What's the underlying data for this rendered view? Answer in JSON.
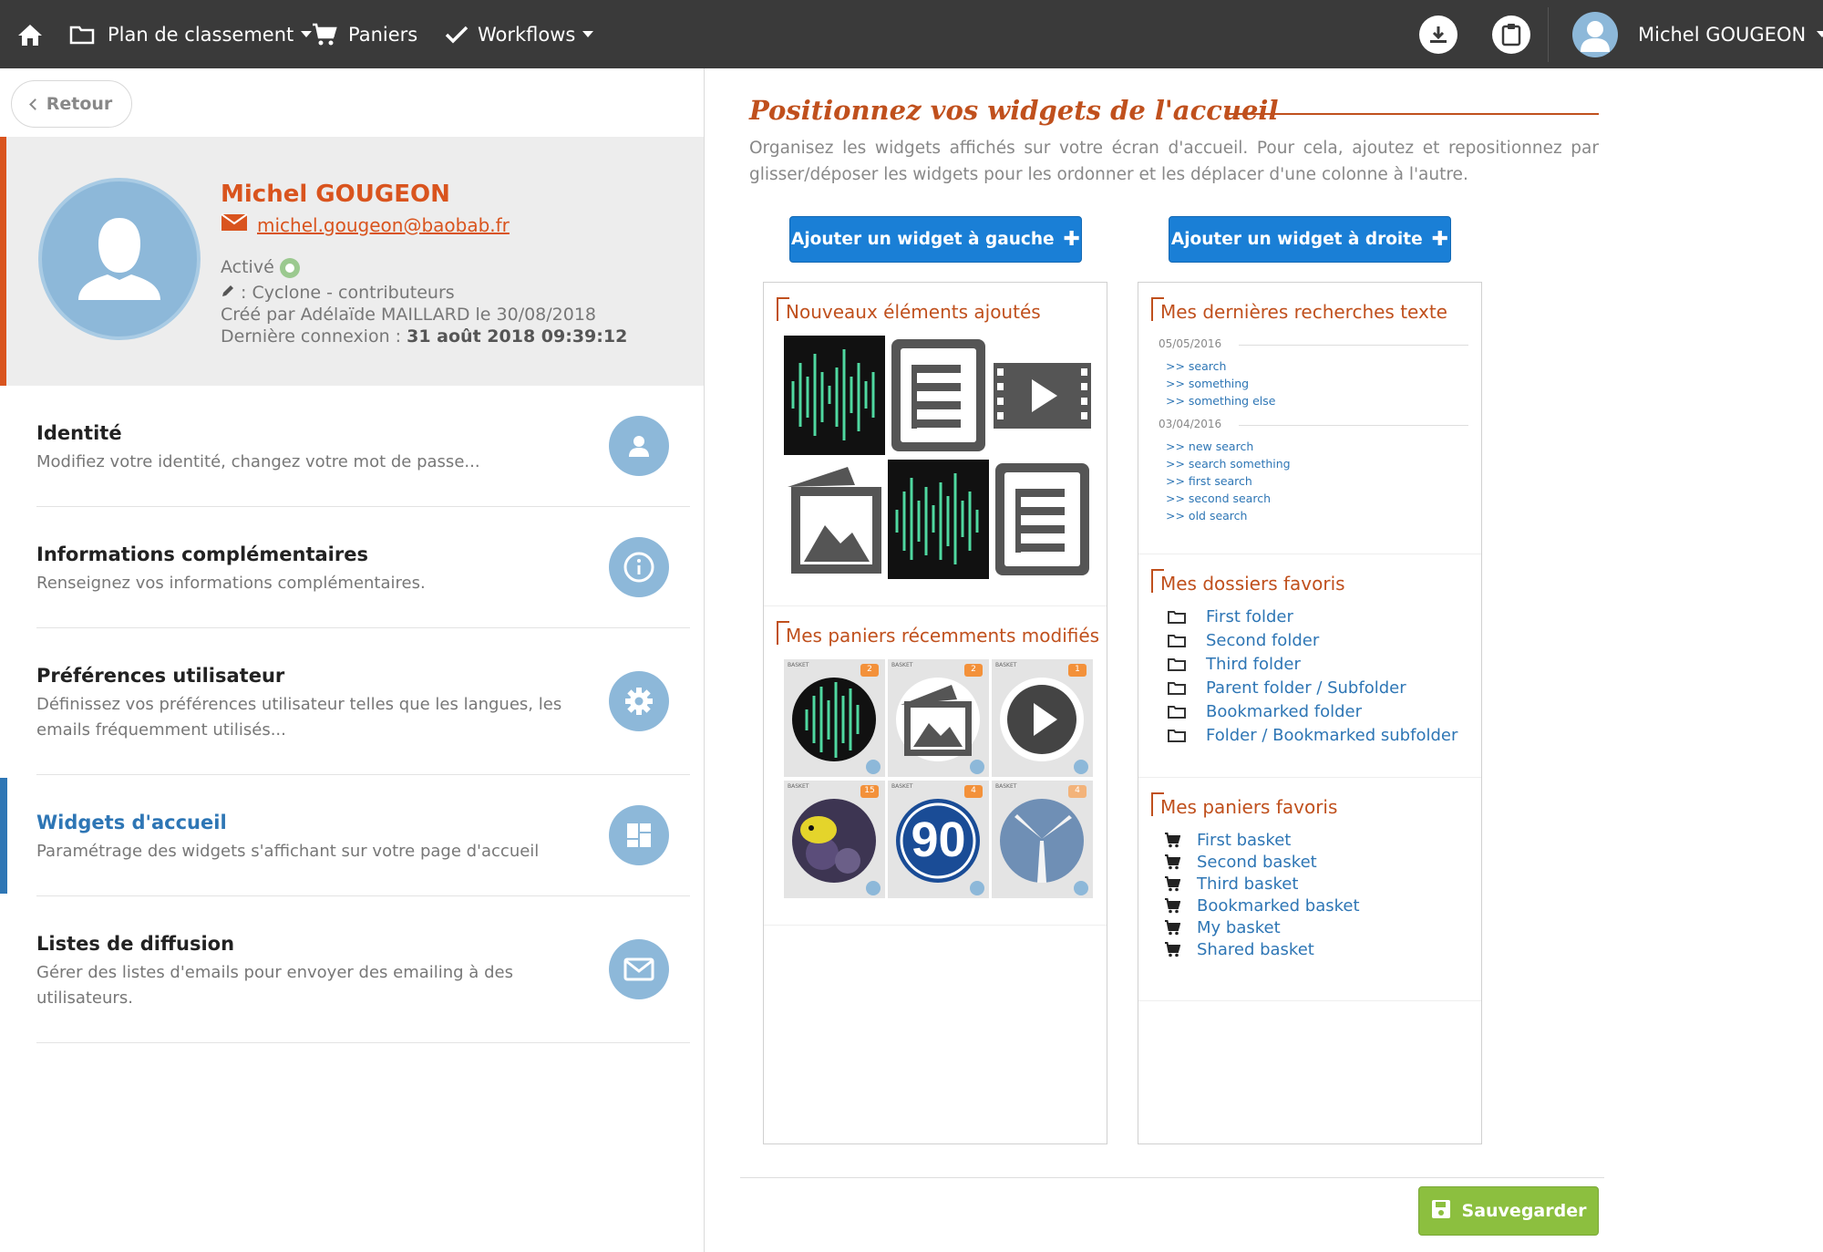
{
  "nav": {
    "plan_label": "Plan de classement",
    "baskets_label": "Paniers",
    "workflows_label": "Workflows",
    "user_name": "Michel GOUGEON"
  },
  "back_label": "Retour",
  "profile": {
    "name": "Michel GOUGEON",
    "email": "michel.gougeon@baobab.fr",
    "status": "Activé",
    "group": ": Cyclone - contributeurs",
    "created": "Créé par Adélaïde MAILLARD le 30/08/2018",
    "last_login_label": "Dernière connexion : ",
    "last_login_value": "31 août 2018 09:39:12"
  },
  "menu": [
    {
      "title": "Identité",
      "desc": "Modifiez votre identité, changez votre mot de passe..."
    },
    {
      "title": "Informations complémentaires",
      "desc": "Renseignez vos informations complémentaires."
    },
    {
      "title": "Préférences utilisateur",
      "desc": "Définissez vos préférences utilisateur telles que les langues, les emails fréquemment utilisés..."
    },
    {
      "title": "Widgets d'accueil",
      "desc": "Paramétrage des widgets s'affichant sur votre page d'accueil"
    },
    {
      "title": "Listes de diffusion",
      "desc": "Gérer des listes d'emails pour envoyer des emailing à des utilisateurs."
    }
  ],
  "main": {
    "title": "Positionnez vos widgets de l'accueil",
    "description": "Organisez les widgets affichés sur votre écran d'accueil. Pour cela, ajoutez et repositionnez par glisser/déposer les widgets pour les ordonner et les déplacer d'une colonne à l'autre.",
    "add_left": "Ajouter un widget à gauche",
    "add_right": "Ajouter un widget à droite",
    "save": "Sauvegarder"
  },
  "widgets": {
    "new_items_title": "Nouveaux éléments ajoutés",
    "baskets_title": "Mes paniers récemments modifiés",
    "basket_thumbs": [
      {
        "tag": "BASKET",
        "count": "2"
      },
      {
        "tag": "BASKET",
        "count": "2"
      },
      {
        "tag": "BASKET",
        "count": "1"
      },
      {
        "tag": "BASKET",
        "count": "15"
      },
      {
        "tag": "BASKET",
        "count": "4",
        "number": "90"
      },
      {
        "tag": "BASKET",
        "count": "4"
      }
    ],
    "searches_title": "Mes dernières recherches texte",
    "search_groups": [
      {
        "date": "05/05/2016",
        "items": [
          ">> search",
          ">> something",
          ">> something else"
        ]
      },
      {
        "date": "03/04/2016",
        "items": [
          ">> new search",
          ">> search something",
          ">> first search",
          ">> second search",
          ">> old search"
        ]
      }
    ],
    "folders_title": "Mes dossiers favoris",
    "folders": [
      "First folder",
      "Second folder",
      "Third folder",
      "Parent folder / Subfolder",
      "Bookmarked folder",
      "Folder / Bookmarked subfolder"
    ],
    "fav_baskets_title": "Mes paniers favoris",
    "fav_baskets": [
      "First basket",
      "Second basket",
      "Third basket",
      "Bookmarked basket",
      "My basket",
      "Shared basket"
    ]
  },
  "colors": {
    "accent_orange": "#d9541e",
    "title_orange": "#c0501d",
    "link_blue": "#2e76b5",
    "button_blue": "#1a7fd6",
    "save_green": "#8cbf3f",
    "avatar_blue": "#8db8d9",
    "topbar_dark": "#3a3a3a"
  }
}
